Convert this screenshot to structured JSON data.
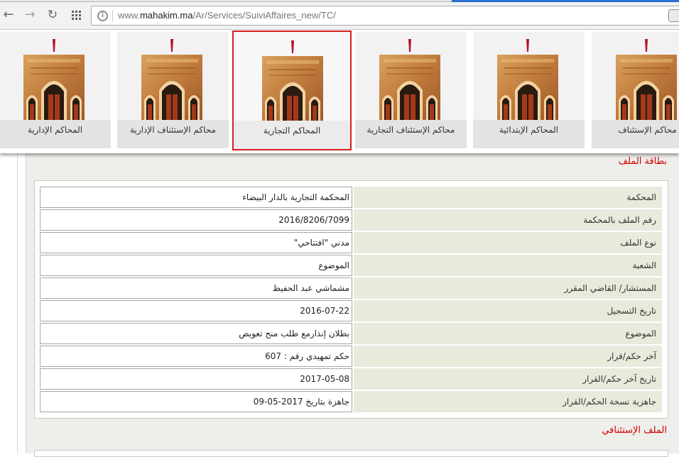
{
  "browser": {
    "url_prefix": "www.",
    "url_host": "mahakim.ma",
    "url_path": "/Ar/Services/SuiviAffaires_new/TC/",
    "back_icon": "arrow-left-icon",
    "forward_icon": "arrow-right-icon",
    "reload_icon": "reload-icon",
    "apps_icon": "apps-grid-icon"
  },
  "courts": [
    {
      "label": "المحاكم الإدارية",
      "selected": false
    },
    {
      "label": "محاكم الإستئناف الإدارية",
      "selected": false
    },
    {
      "label": "المحاكم التجارية",
      "selected": true
    },
    {
      "label": "محاكم الإستئناف التجارية",
      "selected": false
    },
    {
      "label": "المحاكم الإبتدائية",
      "selected": false
    },
    {
      "label": "محاكم الإستئناف",
      "selected": false
    }
  ],
  "file_card": {
    "title": "بطاقة الملف",
    "rows": [
      {
        "label": "المحكمة",
        "value": "المحكمة التجارية بالدار البيضاء"
      },
      {
        "label": "رقم الملف بالمحكمة",
        "value": "2016/8206/7099"
      },
      {
        "label": "نوع الملف",
        "value": "مدني \"افتتاحي\""
      },
      {
        "label": "الشعبة",
        "value": "الموضوع"
      },
      {
        "label": "المستشار/ القاضي المقرر",
        "value": "مشماشي عبد الحفيظ"
      },
      {
        "label": "تاريخ التسجيل",
        "value": "2016-07-22"
      },
      {
        "label": "الموضوع",
        "value": "بطلان إنذارمع طلب منح تعويض"
      },
      {
        "label": "آخر حكم/قرار",
        "value": "حكم تمهيدي رقم : 607"
      },
      {
        "label": "تاريخ آخر حكم/القرار",
        "value": "2017-05-08"
      },
      {
        "label": "جاهزية نسخة الحكم/القرار",
        "value": "جاهزة بتاريخ 2017-05-09"
      }
    ]
  },
  "appeal_section": {
    "title": "الملف الإستئنافي"
  }
}
